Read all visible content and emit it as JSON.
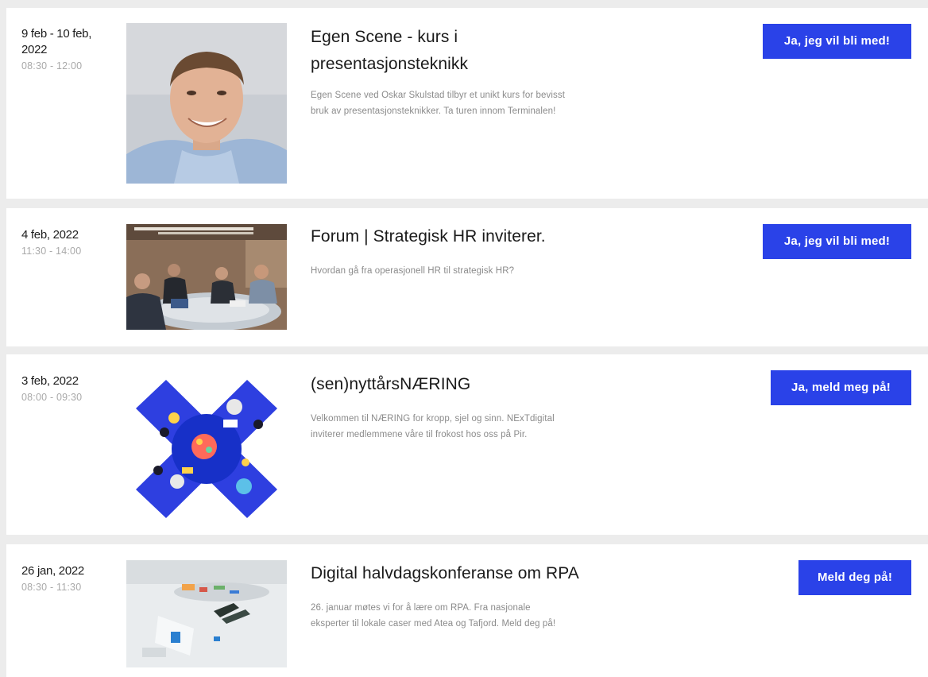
{
  "events": [
    {
      "date_line1": "9 feb - 10 feb,",
      "date_line2": "2022",
      "time": "08:30 - 12:00",
      "title_line1": "Egen Scene - kurs i",
      "title_line2": "presentasjonsteknikk",
      "desc_line1": "Egen Scene ved Oskar Skulstad tilbyr et unikt kurs for bevisst",
      "desc_line2": "bruk av presentasjonsteknikker. Ta turen innom Terminalen!",
      "button_label": "Ja, jeg vil bli med!",
      "image": "man-portrait-photo"
    },
    {
      "date_line1": "4 feb, 2022",
      "time": "11:30 - 14:00",
      "title_line1": "Forum | Strategisk HR inviterer.",
      "desc_line1": "Hvordan gå fra operasjonell HR til strategisk HR?",
      "button_label": "Ja, jeg vil bli med!",
      "image": "meeting-room-photo"
    },
    {
      "date_line1": "3 feb, 2022",
      "time": "08:00 - 09:30",
      "title_line1": "(sen)nyttårsNÆRING",
      "desc_line1": "Velkommen til NÆRING for kropp, sjel og sinn. NExTdigital",
      "desc_line2": "inviterer medlemmene våre til frokost hos oss på Pir.",
      "button_label": "Ja, meld meg på!",
      "image": "blue-x-illustration"
    },
    {
      "date_line1": "26 jan, 2022",
      "time": "08:30 - 11:30",
      "title_line1": "Digital halvdagskonferanse om RPA",
      "desc_line1": "26. januar møtes vi for å lære om RPA. Fra nasjonale",
      "desc_line2": "eksperter til lokale caser med Atea og Tafjord. Meld deg på!",
      "button_label": "Meld deg på!",
      "image": "desk-items-photo"
    }
  ],
  "colors": {
    "accent": "#2a42e8",
    "background": "#ececec",
    "card": "#ffffff",
    "muted_text": "#8b8b8b"
  }
}
